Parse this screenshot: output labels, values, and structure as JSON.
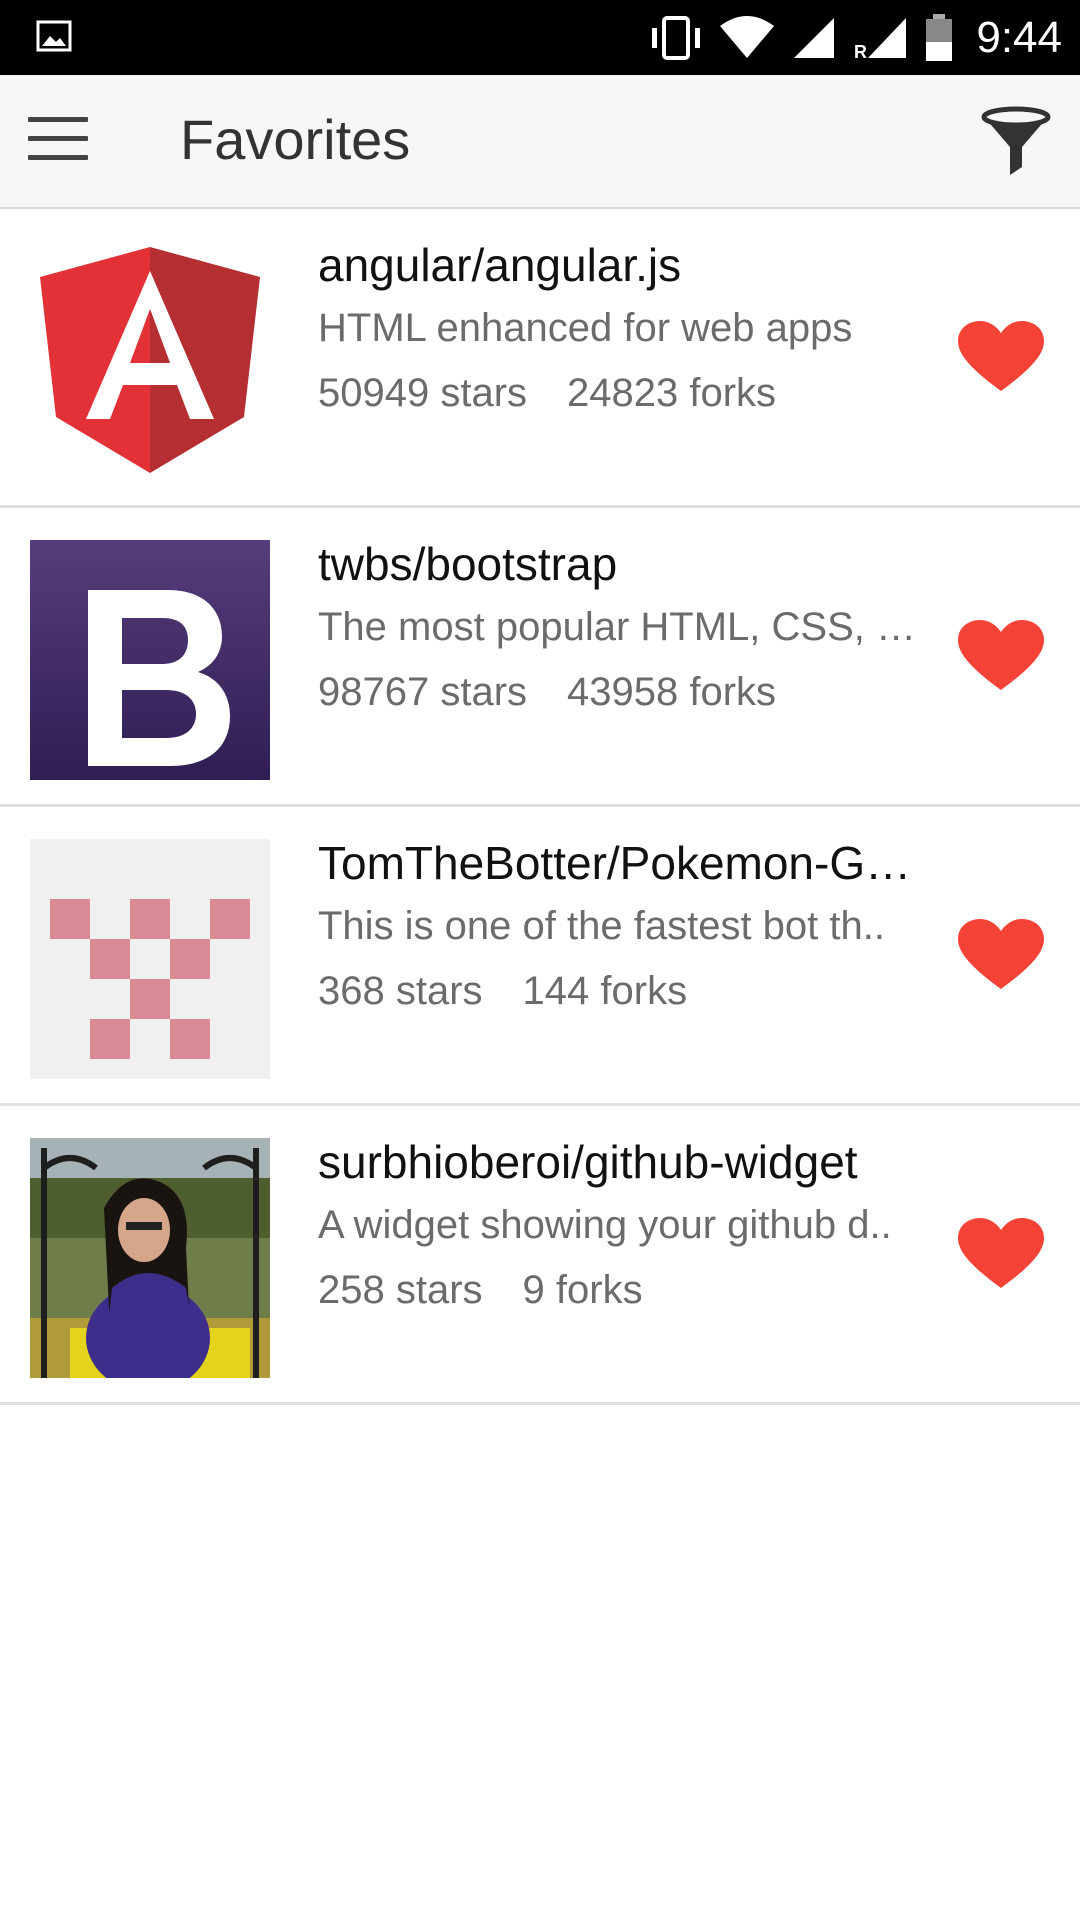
{
  "status_bar": {
    "time": "9:44",
    "icons": [
      "image-notification-icon",
      "vibrate-icon",
      "wifi-icon",
      "signal-icon",
      "battery-icon"
    ]
  },
  "app_bar": {
    "title": "Favorites",
    "menu_icon": "hamburger-menu-icon",
    "filter_icon": "filter-funnel-icon"
  },
  "colors": {
    "heart": "#F44336",
    "angular_red": "#DD1B16",
    "bootstrap_purple": "#563D7C",
    "pixel_pink": "#D98A94"
  },
  "repos": [
    {
      "name": "angular/angular.js",
      "description": "HTML enhanced for web apps",
      "stars": "50949 stars",
      "forks": "24823 forks",
      "avatar": "angular-logo"
    },
    {
      "name": "twbs/bootstrap",
      "description": "The most popular HTML, CSS, …",
      "stars": "98767 stars",
      "forks": "43958 forks",
      "avatar": "bootstrap-logo"
    },
    {
      "name": "TomTheBotter/Pokemon-G…",
      "description": "This is one of the fastest bot th..",
      "stars": "368 stars",
      "forks": "144 forks",
      "avatar": "identicon"
    },
    {
      "name": "surbhioberoi/github-widget",
      "description": "A widget showing your github d..",
      "stars": "258 stars",
      "forks": "9 forks",
      "avatar": "user-photo"
    }
  ]
}
